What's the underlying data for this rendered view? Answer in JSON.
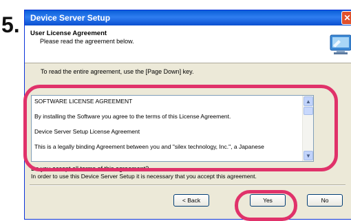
{
  "step": {
    "number": "5."
  },
  "window": {
    "title": "Device Server Setup",
    "close_glyph": "✕"
  },
  "header": {
    "title": "User License Agreement",
    "subtitle": "Please read the agreement below."
  },
  "main": {
    "instruction": "To read the entire agreement, use the [Page Down] key.",
    "license_lines": [
      "SOFTWARE LICENSE AGREEMENT",
      "By installing the Software you agree to the terms of this License Agreement.",
      "Device Server Setup License Agreement",
      "This is a legally binding Agreement between you and \"silex technology, Inc.\", a Japanese"
    ],
    "question": "Do you accept all terms of this agreement?",
    "accept_note": "In order to use this Device Server Setup it is necessary that you accept this agreement."
  },
  "buttons": {
    "back": "< Back",
    "yes": "Yes",
    "no": "No"
  },
  "icons": {
    "header_icon": "computer-setup-icon",
    "scroll_up": "scroll-up-arrow-icon",
    "scroll_down": "scroll-down-arrow-icon"
  },
  "colors": {
    "highlight": "#e0326a",
    "titlebar": "#0a5fd8"
  }
}
